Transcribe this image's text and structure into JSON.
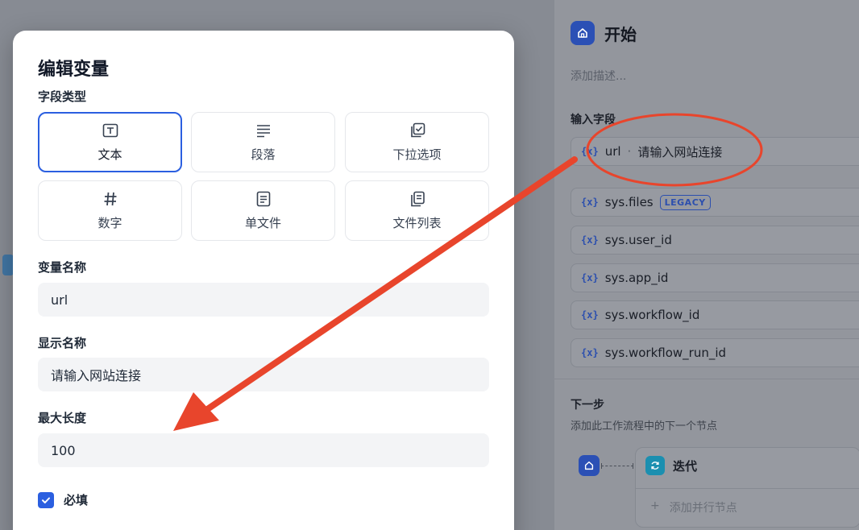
{
  "modal": {
    "title": "编辑变量",
    "field_type_label": "字段类型",
    "types": [
      {
        "label": "文本",
        "icon": "text-icon",
        "selected": true
      },
      {
        "label": "段落",
        "icon": "paragraph-icon",
        "selected": false
      },
      {
        "label": "下拉选项",
        "icon": "select-icon",
        "selected": false
      },
      {
        "label": "数字",
        "icon": "number-icon",
        "selected": false
      },
      {
        "label": "单文件",
        "icon": "file-icon",
        "selected": false
      },
      {
        "label": "文件列表",
        "icon": "file-list-icon",
        "selected": false
      }
    ],
    "var_name_label": "变量名称",
    "var_name_value": "url",
    "display_name_label": "显示名称",
    "display_name_value": "请输入网站连接",
    "max_length_label": "最大长度",
    "max_length_value": "100",
    "required_label": "必填",
    "required_checked": true
  },
  "panel": {
    "title": "开始",
    "description_placeholder": "添加描述...",
    "input_fields_label": "输入字段",
    "fields": [
      {
        "symbol": "{x}",
        "name": "url",
        "separator": "·",
        "display": "请输入网站连接"
      },
      {
        "symbol": "{x}",
        "name": "sys.files",
        "badge": "LEGACY"
      },
      {
        "symbol": "{x}",
        "name": "sys.user_id"
      },
      {
        "symbol": "{x}",
        "name": "sys.app_id"
      },
      {
        "symbol": "{x}",
        "name": "sys.workflow_id"
      },
      {
        "symbol": "{x}",
        "name": "sys.workflow_run_id"
      }
    ],
    "next_step_label": "下一步",
    "next_step_desc": "添加此工作流程中的下一个节点",
    "next_node_label": "迭代",
    "add_parallel_icon": "+",
    "add_parallel_label": "添加并行节点"
  },
  "colors": {
    "accent": "#2b5fe0",
    "annotation": "#e8452c"
  }
}
